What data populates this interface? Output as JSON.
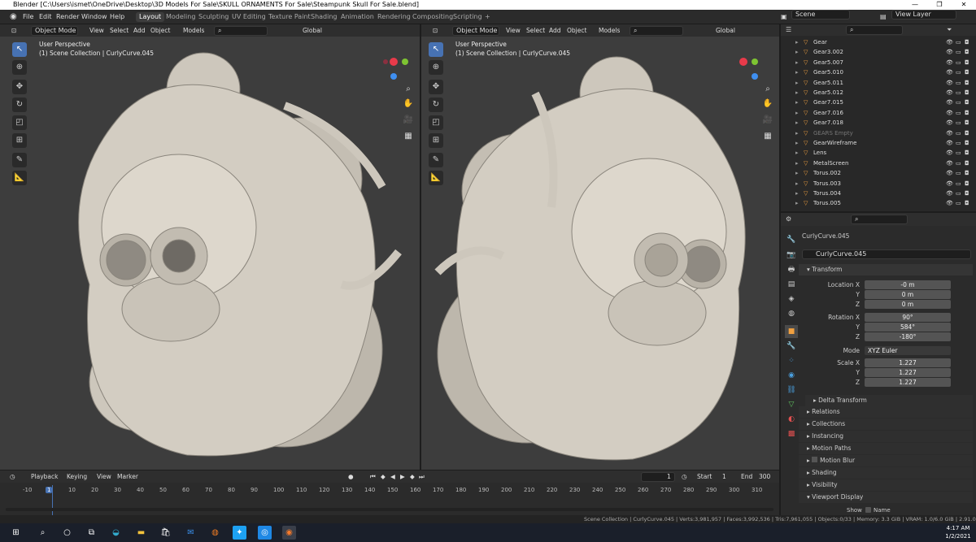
{
  "window": {
    "title": "Blender [C:\\Users\\ismet\\OneDrive\\Desktop\\3D Models For Sale\\SKULL ORNAMENTS For Sale\\Steampunk Skull For Sale.blend]"
  },
  "menus": [
    "File",
    "Edit",
    "Render",
    "Window",
    "Help"
  ],
  "workspaces": [
    "Layout",
    "Modeling",
    "Sculpting",
    "UV Editing",
    "Texture Paint",
    "Shading",
    "Animation",
    "Rendering",
    "Compositing",
    "Scripting"
  ],
  "active_workspace": "Layout",
  "scene": "Scene",
  "view_layer": "View Layer",
  "viewport_header": {
    "mode": "Object Mode",
    "view": "View",
    "select": "Select",
    "add": "Add",
    "object": "Object",
    "models": "Models",
    "orientation": "Global"
  },
  "viewports": [
    {
      "perspective": "User Perspective",
      "collection": "(1) Scene Collection | CurlyCurve.045"
    },
    {
      "perspective": "User Perspective",
      "collection": "(1) Scene Collection | CurlyCurve.045"
    }
  ],
  "outliner": [
    {
      "name": "Gear",
      "dim": false
    },
    {
      "name": "Gear3.002",
      "dim": false
    },
    {
      "name": "Gear5.007",
      "dim": false
    },
    {
      "name": "Gear5.010",
      "dim": false
    },
    {
      "name": "Gear5.011",
      "dim": false
    },
    {
      "name": "Gear5.012",
      "dim": false
    },
    {
      "name": "Gear7.015",
      "dim": false
    },
    {
      "name": "Gear7.016",
      "dim": false
    },
    {
      "name": "Gear7.018",
      "dim": false
    },
    {
      "name": "GEARS Empty",
      "dim": true
    },
    {
      "name": "GearWireframe",
      "dim": false
    },
    {
      "name": "Lens",
      "dim": false
    },
    {
      "name": "MetalScreen",
      "dim": false
    },
    {
      "name": "Torus.002",
      "dim": false
    },
    {
      "name": "Torus.003",
      "dim": false
    },
    {
      "name": "Torus.004",
      "dim": false
    },
    {
      "name": "Torus.005",
      "dim": false
    }
  ],
  "properties": {
    "object_name": "CurlyCurve.045",
    "object_field": "CurlyCurve.045",
    "transform_label": "Transform",
    "location": {
      "label": "Location X",
      "x": "-0 m",
      "y": "0 m",
      "z": "0 m"
    },
    "rotation": {
      "label": "Rotation X",
      "x": "90°",
      "y": "584°",
      "z": "-180°"
    },
    "mode_label": "Mode",
    "mode": "XYZ Euler",
    "scale": {
      "label": "Scale X",
      "x": "1.227",
      "y": "1.227",
      "z": "1.227"
    },
    "axis_y": "Y",
    "axis_z": "Z",
    "panels": [
      "Delta Transform",
      "Relations",
      "Collections",
      "Instancing",
      "Motion Paths",
      "Motion Blur",
      "Shading",
      "Visibility",
      "Viewport Display"
    ],
    "show_label": "Show",
    "name_label": "Name"
  },
  "timeline": {
    "menus": [
      "Playback",
      "Keying",
      "View",
      "Marker"
    ],
    "current_frame": "1",
    "start_label": "Start",
    "start": "1",
    "end_label": "End",
    "end": "300",
    "ticks": [
      "-10",
      "1",
      "10",
      "20",
      "30",
      "40",
      "50",
      "60",
      "70",
      "80",
      "90",
      "100",
      "110",
      "120",
      "130",
      "140",
      "150",
      "160",
      "170",
      "180",
      "190",
      "200",
      "210",
      "220",
      "230",
      "240",
      "250",
      "260",
      "270",
      "280",
      "290",
      "300",
      "310"
    ]
  },
  "statusbar": "Scene Collection | CurlyCurve.045 | Verts:3,981,957 | Faces:3,992,536 | Tris:7,961,055 | Objects:0/33 | Memory: 3.3 GiB | VRAM: 1.0/6.0 GiB | 2.91.0",
  "taskbar": {
    "time": "4:17 AM",
    "date": "1/2/2021"
  },
  "colors": {
    "accent": "#4772b3",
    "axis_x": "#e83a4a",
    "axis_y": "#7ec432",
    "axis_z": "#3f8ff0",
    "model": "#cdc7bc"
  }
}
